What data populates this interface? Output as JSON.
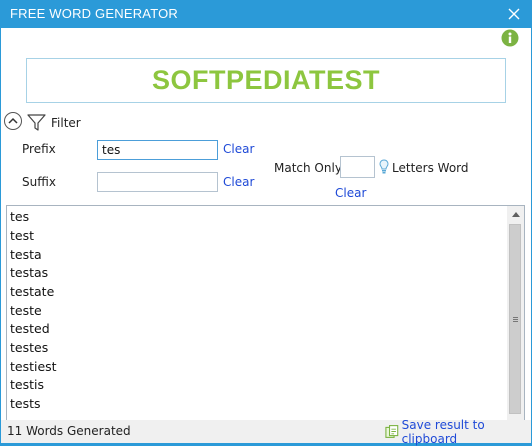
{
  "window": {
    "title": "FREE WORD GENERATOR"
  },
  "banner": {
    "text": "SOFTPEDIATEST",
    "color": "#8dc63f"
  },
  "filter": {
    "label": "Filter",
    "prefix": {
      "label": "Prefix",
      "value": "tes",
      "clear_label": "Clear"
    },
    "suffix": {
      "label": "Suffix",
      "value": "",
      "clear_label": "Clear"
    },
    "match_only": {
      "label": "Match Only",
      "value": "",
      "suffix_label": "Letters Word",
      "clear_label": "Clear"
    }
  },
  "words": [
    "tes",
    "test",
    "testa",
    "testas",
    "testate",
    "teste",
    "tested",
    "testes",
    "testiest",
    "testis",
    "tests"
  ],
  "status": {
    "text": "11 Words Generated",
    "save_label": "Save result to clipboard"
  },
  "colors": {
    "titlebar": "#2b9ad8",
    "link": "#1f4ad7",
    "accent_green": "#8dc63f"
  },
  "icons": [
    "close-icon",
    "info-icon",
    "collapse-chevron-icon",
    "filter-funnel-icon",
    "lightbulb-icon",
    "clipboard-icon"
  ]
}
